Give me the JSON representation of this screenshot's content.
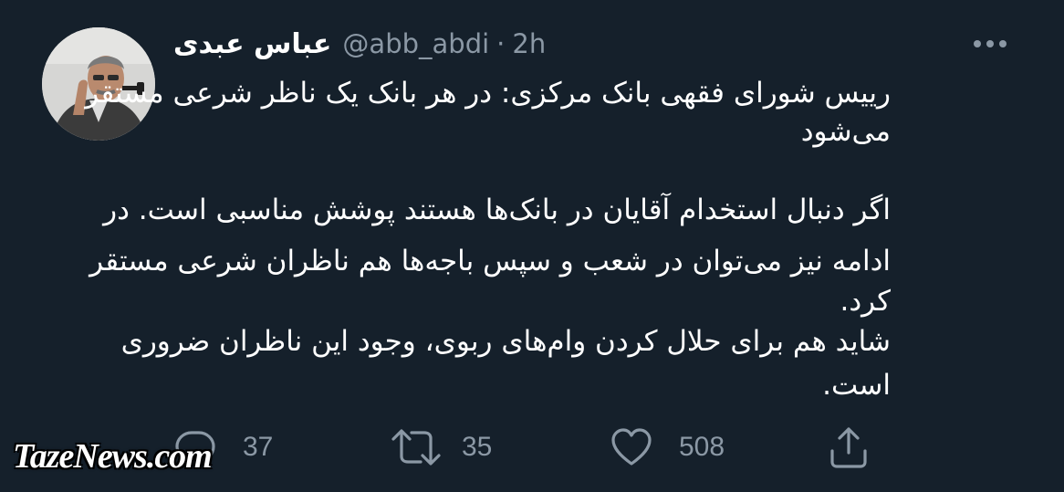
{
  "tweet": {
    "display_name": "عباس عبدی",
    "handle": "@abb_abdi",
    "separator": "·",
    "timestamp": "2h",
    "lines": [
      "رییس شورای فقهی بانک مرکزی: در هر بانک یک ناظر شرعی مستقر",
      "می‌شود",
      "اگر دنبال استخدام آقایان در بانک‌ها هستند پوشش مناسبی است. در",
      "ادامه نیز می‌توان در شعب و سپس باجه‌ها هم ناظران شرعی مستقر",
      "کرد.",
      "شاید هم برای حلال کردن وام‌های ربوی، وجود این ناظران ضروری",
      "است."
    ]
  },
  "actions": {
    "reply_count": "37",
    "retweet_count": "35",
    "like_count": "508"
  },
  "icons": {
    "reply": "reply-bubble-icon",
    "retweet": "retweet-icon",
    "like": "heart-icon",
    "share": "share-icon",
    "more": "more-dots-icon"
  },
  "colors": {
    "background": "#15202b",
    "text": "#ffffff",
    "muted": "#8b98a5"
  },
  "watermark": "TazeNews.com"
}
